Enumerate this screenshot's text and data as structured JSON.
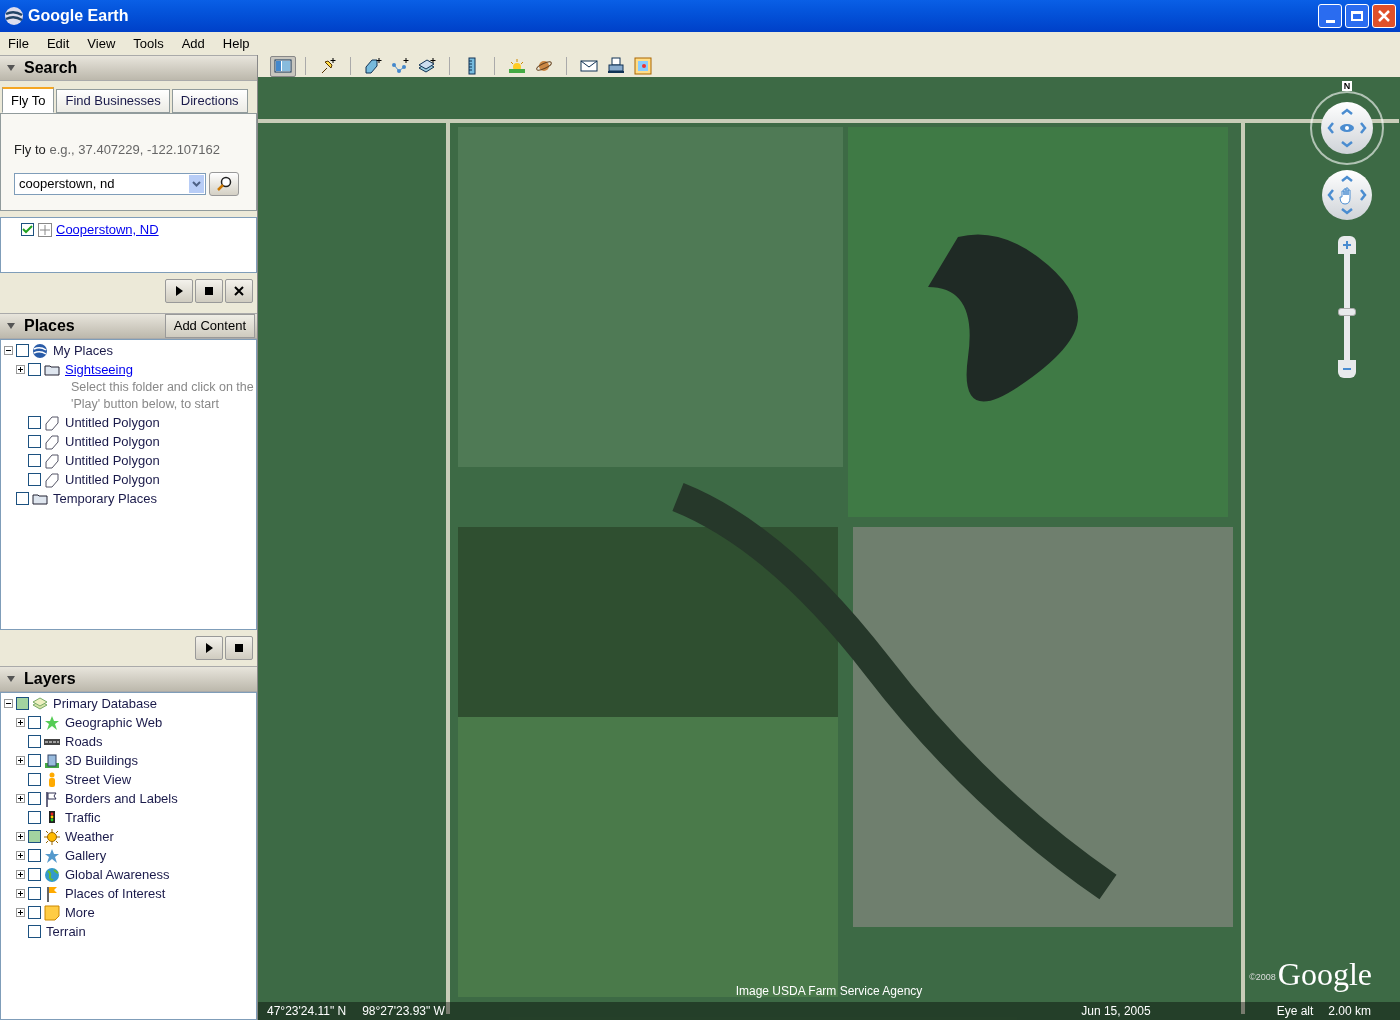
{
  "window": {
    "title": "Google Earth"
  },
  "menu": [
    "File",
    "Edit",
    "View",
    "Tools",
    "Add",
    "Help"
  ],
  "toolbar": [
    {
      "kind": "sidebar",
      "selected": true
    },
    {
      "kind": "placemark",
      "selected": false
    },
    {
      "kind": "polygon",
      "selected": false
    },
    {
      "kind": "path",
      "selected": false
    },
    {
      "kind": "overlay",
      "selected": false
    },
    {
      "kind": "ruler",
      "selected": false
    },
    {
      "kind": "sun",
      "selected": false
    },
    {
      "kind": "planet",
      "selected": false
    },
    {
      "kind": "email",
      "selected": false
    },
    {
      "kind": "print",
      "selected": false
    },
    {
      "kind": "maps",
      "selected": false
    }
  ],
  "search": {
    "title": "Search",
    "tabs": [
      {
        "label": "Fly To",
        "selected": true
      },
      {
        "label": "Find Businesses",
        "selected": false
      },
      {
        "label": "Directions",
        "selected": false
      }
    ],
    "hint_label": "Fly to",
    "hint": "e.g., 37.407229, -122.107162",
    "value": "cooperstown, nd",
    "results": [
      {
        "label": "Cooperstown, ND",
        "checked": true
      }
    ]
  },
  "places": {
    "title": "Places",
    "add_button": "Add Content",
    "tree": [
      {
        "label": "My Places",
        "kind": "earth",
        "checked": false,
        "partial": false,
        "expanded": true,
        "children": [
          {
            "label": "Sightseeing",
            "kind": "folder",
            "link": true,
            "checked": false,
            "partial": false,
            "expanded": false,
            "description": "Select this folder and click on the 'Play' button below, to start"
          },
          {
            "label": "Untitled Polygon",
            "kind": "polygon",
            "checked": false,
            "partial": false
          },
          {
            "label": "Untitled Polygon",
            "kind": "polygon",
            "checked": false,
            "partial": false
          },
          {
            "label": "Untitled Polygon",
            "kind": "polygon",
            "checked": false,
            "partial": false
          },
          {
            "label": "Untitled Polygon",
            "kind": "polygon",
            "checked": false,
            "partial": false
          }
        ]
      },
      {
        "label": "Temporary Places",
        "kind": "folder",
        "checked": false,
        "partial": false
      }
    ]
  },
  "layers": {
    "title": "Layers",
    "tree": [
      {
        "label": "Primary Database",
        "kind": "layers",
        "checked": false,
        "partial": true,
        "expanded": true,
        "children": [
          {
            "label": "Geographic Web",
            "kind": "star",
            "checked": false,
            "partial": false,
            "expanded": false
          },
          {
            "label": "Roads",
            "kind": "roads",
            "checked": false,
            "partial": false
          },
          {
            "label": "3D Buildings",
            "kind": "building",
            "checked": false,
            "partial": false,
            "expanded": false
          },
          {
            "label": "Street View",
            "kind": "person",
            "checked": false,
            "partial": false
          },
          {
            "label": "Borders and Labels",
            "kind": "flag",
            "checked": false,
            "partial": false,
            "expanded": false
          },
          {
            "label": "Traffic",
            "kind": "traffic",
            "checked": false,
            "partial": false
          },
          {
            "label": "Weather",
            "kind": "sun",
            "checked": false,
            "partial": true,
            "expanded": false
          },
          {
            "label": "Gallery",
            "kind": "bluestar",
            "checked": false,
            "partial": false,
            "expanded": false
          },
          {
            "label": "Global Awareness",
            "kind": "globe",
            "checked": false,
            "partial": false,
            "expanded": false
          },
          {
            "label": "Places of Interest",
            "kind": "pin",
            "checked": false,
            "partial": false,
            "expanded": false
          },
          {
            "label": "More",
            "kind": "note",
            "checked": false,
            "partial": false,
            "expanded": false
          },
          {
            "label": "Terrain",
            "kind": "none",
            "checked": false,
            "partial": false
          }
        ]
      }
    ]
  },
  "map": {
    "zoom": {
      "level": 0.45
    },
    "compass": "N",
    "attribution": "Image USDA Farm Service Agency",
    "copyright": "©2008",
    "logo": "Google",
    "latitude": "47°23'24.11\" N",
    "longitude": "98°27'23.93\" W",
    "date": "Jun 15, 2005",
    "eye_alt_label": "Eye alt",
    "eye_alt": "2.00 km"
  }
}
